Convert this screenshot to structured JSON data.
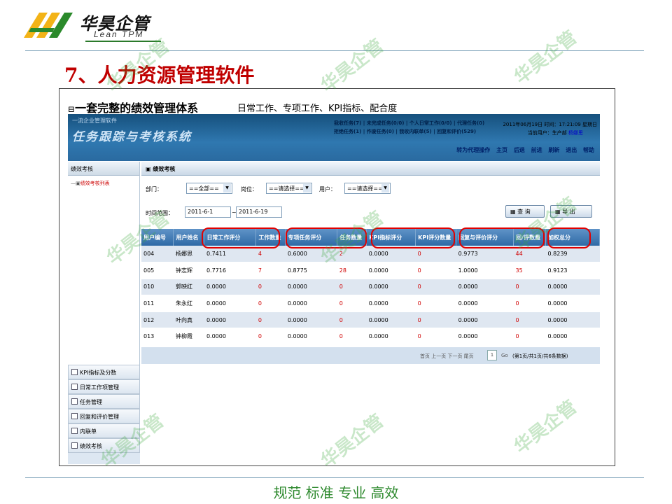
{
  "slide": {
    "logo_cn": "华昊企管",
    "logo_en": "Lean TPM",
    "title": "7、人力资源管理软件",
    "footer": "规范 标准 专业 高效",
    "watermark": "华昊企管",
    "accent": "#c00000",
    "footer_color": "#2f8a2f"
  },
  "frame": {
    "heading": "一套完整的绩效管理体系",
    "subheading": "日常工作、专项工作、KPI指标、配合度"
  },
  "banner": {
    "small_title": "一流企业管理软件",
    "app_title": "任务跟踪与考核系统",
    "stats_row1": "我收任务(7) | 未完成任务(0/0) | 个人日常工作(0/0) | 代理任务(0)",
    "stats_row2": "拒绝任务(1) | 作废任务(0) | 我收内联单(5) | 回复和评价(529)",
    "datetime": "2011年06月19日 时间：17:21:09 星期日",
    "current_user_label": "当前用户：生产部",
    "current_user": "杨娜思",
    "nav": [
      "转为代理操作",
      "主页",
      "后退",
      "前进",
      "刷新",
      "退出",
      "帮助"
    ]
  },
  "sidebar": {
    "header": "绩效考核",
    "tree_item": "绩效考核列表",
    "menu": [
      "KPI指标及分数",
      "日常工作项管理",
      "任务管理",
      "回复和评价管理",
      "内联单",
      "绩效考核"
    ]
  },
  "main": {
    "header": "绩效考核",
    "filters": {
      "dept_label": "部门：",
      "dept_value": "==全部==",
      "post_label": "岗位：",
      "post_value": "==请选择==",
      "user_label": "用户：",
      "user_value": "==请选择==",
      "date_label": "时间范围：",
      "date_from": "2011-6-1",
      "date_sep": "~",
      "date_to": "2011-6-19",
      "query_btn": "查 询",
      "export_btn": "导 出"
    },
    "table": {
      "columns": [
        "用户编号",
        "用户姓名",
        "日常工作评分",
        "工作数量",
        "专项任务评分",
        "任务数量",
        "KPI指标评分",
        "KPI评分数量",
        "回复与评价评分",
        "回/评数量",
        "加权总分"
      ],
      "rows": [
        [
          "004",
          "杨娜思",
          "0.7411",
          "4",
          "0.6000",
          "2",
          "0.0000",
          "0",
          "0.9773",
          "44",
          "0.8239"
        ],
        [
          "005",
          "钟志辉",
          "0.7716",
          "7",
          "0.8775",
          "28",
          "0.0000",
          "0",
          "1.0000",
          "35",
          "0.9123"
        ],
        [
          "010",
          "郭映红",
          "0.0000",
          "0",
          "0.0000",
          "0",
          "0.0000",
          "0",
          "0.0000",
          "0",
          "0.0000"
        ],
        [
          "011",
          "朱永红",
          "0.0000",
          "0",
          "0.0000",
          "0",
          "0.0000",
          "0",
          "0.0000",
          "0",
          "0.0000"
        ],
        [
          "012",
          "叶向真",
          "0.0000",
          "0",
          "0.0000",
          "0",
          "0.0000",
          "0",
          "0.0000",
          "0",
          "0.0000"
        ],
        [
          "013",
          "钟柳霞",
          "0.0000",
          "0",
          "0.0000",
          "0",
          "0.0000",
          "0",
          "0.0000",
          "0",
          "0.0000"
        ]
      ]
    },
    "pager": {
      "text": "首页 上一页 下一页 尾页",
      "page_input": "1",
      "go": "Go",
      "info": "(第1页/共1页/共6条数据)"
    }
  }
}
